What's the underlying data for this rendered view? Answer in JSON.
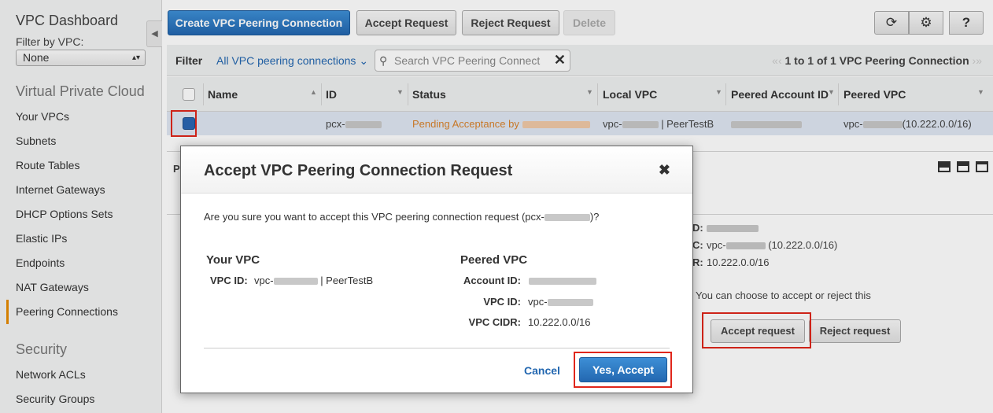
{
  "sidebar": {
    "title": "VPC Dashboard",
    "filter_label": "Filter by VPC:",
    "filter_value": "None",
    "filter_arrow": "▴▾",
    "section_vpc": "Virtual Private Cloud",
    "items": [
      "Your VPCs",
      "Subnets",
      "Route Tables",
      "Internet Gateways",
      "DHCP Options Sets",
      "Elastic IPs",
      "Endpoints",
      "NAT Gateways",
      "Peering Connections"
    ],
    "active_item": "Peering Connections",
    "section_security": "Security",
    "security_items": [
      "Network ACLs",
      "Security Groups"
    ],
    "collapse_icon": "◀"
  },
  "toolbar": {
    "create": "Create VPC Peering Connection",
    "accept": "Accept Request",
    "reject": "Reject Request",
    "delete": "Delete",
    "refresh_icon": "⟳",
    "settings_icon": "⚙",
    "help_icon": "?"
  },
  "filterbar": {
    "label": "Filter",
    "dropdown": "All VPC peering connections ⌄",
    "search_placeholder": "Search VPC Peering Connect",
    "search_icon": "⚲",
    "clear_icon": "✕",
    "pager_prev": "«‹",
    "pager_text": "1 to 1 of 1 VPC Peering Connection",
    "pager_next": "›»"
  },
  "table": {
    "columns": [
      "Name",
      "ID",
      "Status",
      "Local VPC",
      "Peered Account ID",
      "Peered VPC"
    ],
    "sort_asc": "▲",
    "sort_desc": "▼",
    "row": {
      "id": "pcx-",
      "status": "Pending Acceptance by ",
      "local_vpc_prefix": "vpc-",
      "local_vpc_suffix": "| PeerTestB",
      "peered_vpc_prefix": "vpc-",
      "peered_vpc_suffix": "(10.222.0.0/16)"
    }
  },
  "details": {
    "letter_p": "P",
    "label_1": "D:",
    "label_2": "C:",
    "label_3": "R:",
    "vpc_prefix": "vpc-",
    "vpc_cidr_suffix": "(10.222.0.0/16)",
    "cidr": "10.222.0.0/16",
    "accept_note": "You can choose to accept or reject this",
    "accept_btn": "Accept request",
    "reject_btn": "Reject request"
  },
  "modal": {
    "title": "Accept VPC Peering Connection Request",
    "close_icon": "✖",
    "question_prefix": "Are you sure you want to accept this VPC peering connection request (pcx-",
    "question_suffix": ")?",
    "your_vpc_heading": "Your VPC",
    "vpc_id_label": "VPC ID:",
    "your_vpc_prefix": "vpc-",
    "your_vpc_suffix": "| PeerTestB",
    "peered_vpc_heading": "Peered VPC",
    "account_id_label": "Account ID:",
    "peered_vpc_id_label": "VPC ID:",
    "peered_vpc_prefix": "vpc-",
    "vpc_cidr_label": "VPC CIDR:",
    "vpc_cidr_value": "10.222.0.0/16",
    "cancel": "Cancel",
    "confirm": "Yes, Accept"
  }
}
